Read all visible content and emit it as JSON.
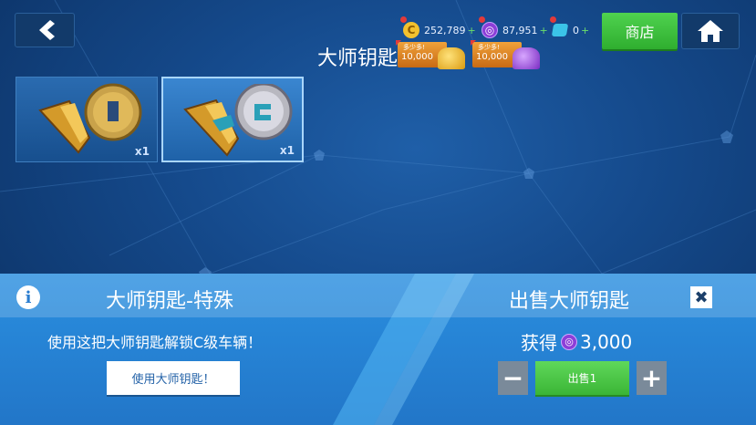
{
  "header": {
    "title": "大师钥匙",
    "shop_label": "商店"
  },
  "currencies": [
    {
      "name": "coin-icon",
      "value": "252,789",
      "plus": "+"
    },
    {
      "name": "purple-coin-icon",
      "value": "87,951",
      "plus": "+"
    },
    {
      "name": "gem-icon",
      "value": "0",
      "plus": "+"
    }
  ],
  "promos": [
    {
      "tag": "多少多!",
      "amount": "10,000"
    },
    {
      "tag": "多少多!",
      "amount": "10,000"
    }
  ],
  "items": [
    {
      "name": "master-key-gold",
      "qty": "x1",
      "selected": false
    },
    {
      "name": "master-key-special",
      "qty": "x1",
      "selected": true
    }
  ],
  "detail": {
    "item_name": "大师钥匙-特殊",
    "description": "使用这把大师钥匙解锁C级车辆！",
    "use_label": "使用大师钥匙！"
  },
  "sell": {
    "title": "出售大师钥匙",
    "earn_label": "获得",
    "earn_amount": "3,000",
    "sell_label": "出售1",
    "minus": "−",
    "plus": "+"
  },
  "colors": {
    "shop_green": "#3fc03f",
    "panel_blue": "#2583d8",
    "purple_currency": "#8c3ed8",
    "gold_currency": "#f2c12e"
  }
}
